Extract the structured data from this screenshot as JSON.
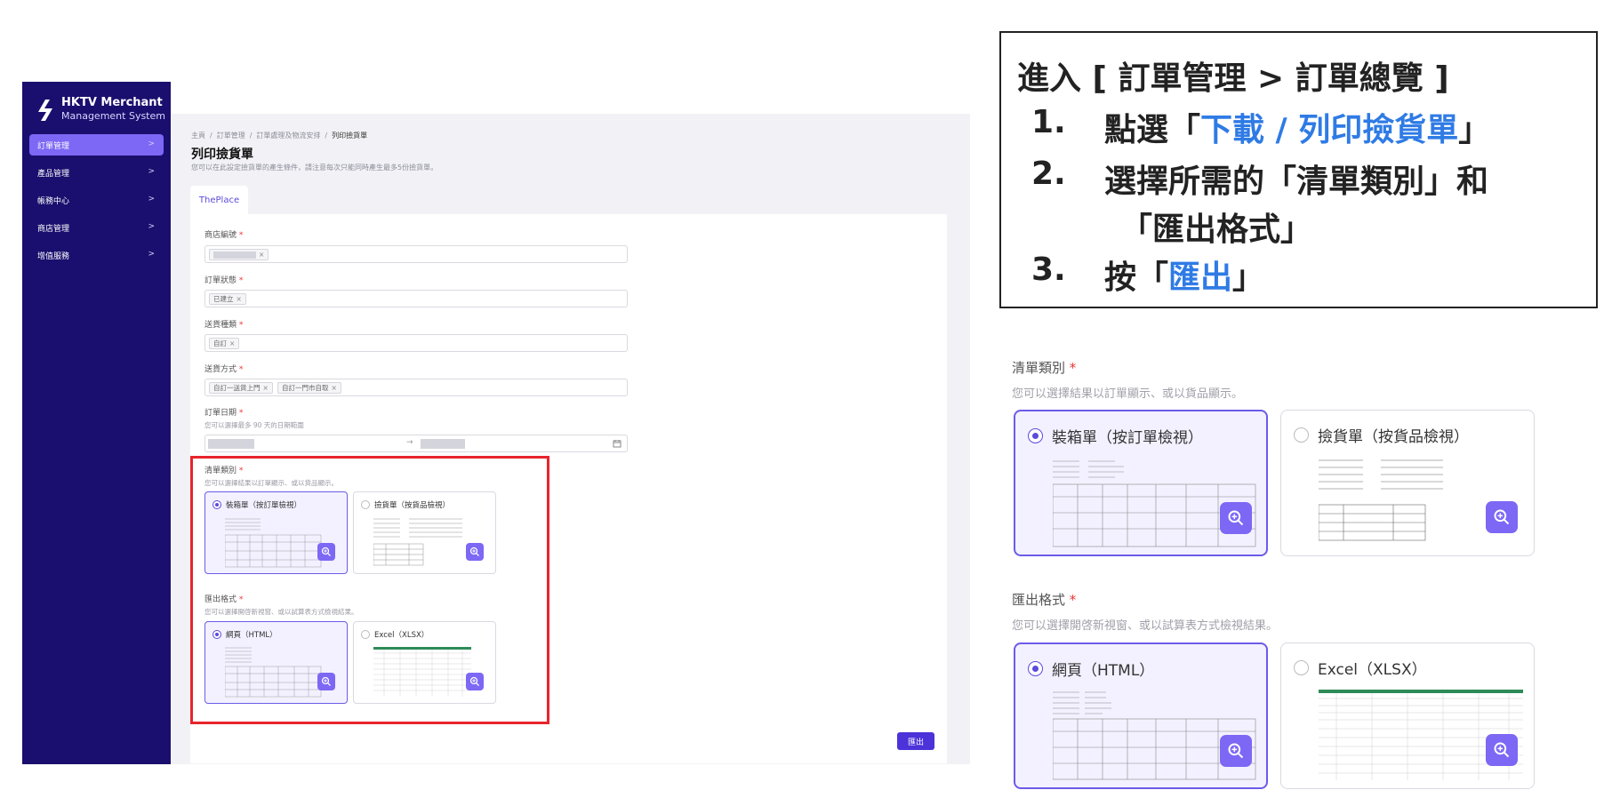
{
  "app": {
    "brand_line1": "HKTV Merchant",
    "brand_line2": "Management System"
  },
  "sidebar": {
    "items": [
      {
        "label": "訂單管理",
        "active": true
      },
      {
        "label": "產品管理",
        "active": false
      },
      {
        "label": "帳務中心",
        "active": false
      },
      {
        "label": "商店管理",
        "active": false
      },
      {
        "label": "增值服務",
        "active": false
      }
    ]
  },
  "breadcrumb": [
    "主頁",
    "訂單管理",
    "訂單處理及物流安排",
    "列印撿貨單"
  ],
  "page": {
    "title": "列印撿貨單",
    "subtitle": "您可以在此設定撿貨單的產生條件，請注意每次只能同時產生最多5份撿貨單。",
    "tab": "ThePlace"
  },
  "form": {
    "store_code_label": "商店編號",
    "order_status_label": "訂單狀態",
    "order_status_tag": "已建立",
    "delivery_type_label": "送貨種類",
    "delivery_type_tag": "自訂",
    "delivery_method_label": "送貨方式",
    "delivery_method_tags": [
      "自訂一送貨上門",
      "自訂一門市自取"
    ],
    "order_date_label": "訂單日期",
    "order_date_hint": "您可以選擇最多 90 天的日期範圍",
    "date_separator": "→",
    "list_type_label": "清單類別",
    "list_type_hint": "您可以選擇結果以訂單顯示、或以貨品顯示。",
    "list_type_options": [
      "裝箱單（按訂單檢視）",
      "撿貨單（按貨品檢視）"
    ],
    "list_type_selected": 0,
    "export_format_label": "匯出格式",
    "export_format_hint": "您可以選擇開啓新視窗、或以試算表方式檢視結果。",
    "export_format_options": [
      "網頁（HTML）",
      "Excel（XLSX）"
    ],
    "export_format_selected": 0,
    "required_mark": "*",
    "tag_close": "×",
    "export_button": "匯出"
  },
  "instructions": {
    "title": "進入 [ 訂單管理 >  訂單總覽 ]",
    "steps": [
      {
        "num": "1.",
        "pre": "點選「",
        "highlight": "下載 / 列印撿貨單",
        "post": "」"
      },
      {
        "num": "2.",
        "pre": "選擇所需的「清單類別」和",
        "highlight": "",
        "post": ""
      },
      {
        "num": "",
        "pre": "「匯出格式」",
        "highlight": "",
        "post": ""
      },
      {
        "num": "3.",
        "pre": "按「",
        "highlight": "匯出",
        "post": "」"
      }
    ]
  },
  "colors": {
    "sidebar_bg": "#1a0f6e",
    "accent": "#7d67f5",
    "primary_button": "#4b33d9",
    "highlight_blue": "#2f7be5",
    "red_box": "#e8242d"
  }
}
